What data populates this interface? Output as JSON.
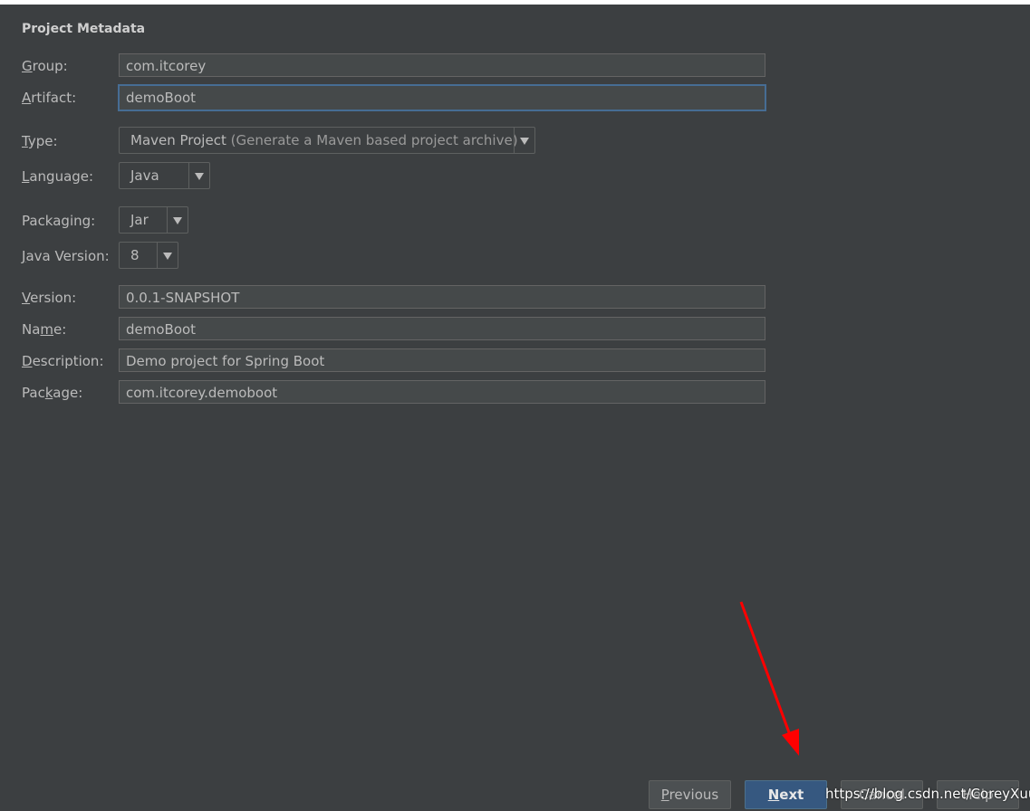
{
  "section": {
    "title": "Project Metadata"
  },
  "fields": {
    "group": {
      "label_mnemonic": "G",
      "label_rest": "roup:",
      "value": "com.itcorey"
    },
    "artifact": {
      "label_mnemonic": "A",
      "label_rest": "rtifact:",
      "value": "demoBoot"
    },
    "version": {
      "label_mnemonic": "V",
      "label_rest": "ersion:",
      "value": "0.0.1-SNAPSHOT"
    },
    "name": {
      "label_pre": "Na",
      "label_mnemonic": "m",
      "label_rest": "e:",
      "value": "demoBoot"
    },
    "description": {
      "label_mnemonic": "D",
      "label_rest": "escription:",
      "value": "Demo project for Spring Boot"
    },
    "package": {
      "label_pre": "Pac",
      "label_mnemonic": "k",
      "label_rest": "age:",
      "value": "com.itcorey.demoboot"
    }
  },
  "combos": {
    "type": {
      "label_mnemonic": "T",
      "label_rest": "ype:",
      "value": "Maven Project",
      "hint": "(Generate a Maven based project archive)"
    },
    "language": {
      "label_mnemonic": "L",
      "label_rest": "anguage:",
      "value": "Java"
    },
    "packaging": {
      "label": "Packaging:",
      "value": "Jar"
    },
    "java_version": {
      "label_mnemonic": "J",
      "label_rest": "ava Version:",
      "value": "8"
    }
  },
  "buttons": {
    "previous": {
      "mnemonic": "P",
      "rest": "revious"
    },
    "next": {
      "mnemonic": "N",
      "rest": "ext"
    },
    "cancel": {
      "label": "Cancel"
    },
    "help": {
      "label": "Help"
    }
  },
  "watermark": "https://blog.csdn.net/CoreyXuu",
  "colors": {
    "background": "#3c3f41",
    "field_background": "#45494a",
    "focus_border": "#466d94",
    "primary_button": "#365880",
    "annotation_arrow": "#ff0000"
  }
}
